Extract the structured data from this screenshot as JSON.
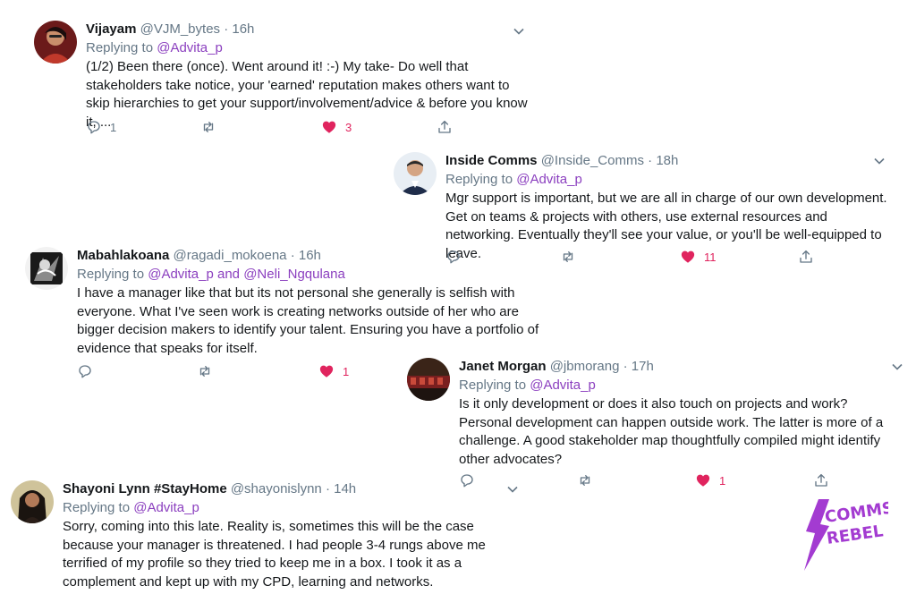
{
  "colors": {
    "accent": "#8b3fbf",
    "like": "#e0245e",
    "muted": "#657786"
  },
  "tweets": [
    {
      "name": "Vijayam",
      "handle": "@VJM_bytes",
      "dot": "·",
      "time": "16h",
      "replying_prefix": "Replying to",
      "replying_to": "@Advita_p",
      "text": "(1/2) Been there (once). Went around it! :-) My take- Do well that stakeholders take notice, your 'earned' reputation makes others want to skip hierarchies to get your support/involvement/advice & before you know it, ...",
      "replies": "1",
      "retweets": "",
      "likes": "3",
      "liked": true
    },
    {
      "name": "Inside Comms",
      "handle": "@Inside_Comms",
      "dot": "·",
      "time": "18h",
      "replying_prefix": "Replying to",
      "replying_to": "@Advita_p",
      "text": "Mgr support is important, but we are all in charge of our own development. Get on teams & projects with others, use external resources and networking. Eventually they'll see your value, or you'll be well-equipped to leave.",
      "replies": "",
      "retweets": "",
      "likes": "11",
      "liked": true
    },
    {
      "name": "Mabahlakoana",
      "handle": "@ragadi_mokoena",
      "dot": "·",
      "time": "16h",
      "replying_prefix": "Replying to",
      "replying_to": "@Advita_p",
      "and": "and",
      "replying_to_2": "@Neli_Ngqulana",
      "text": "I have a manager like that but its not personal she generally is selfish with everyone. What I've seen work is creating networks outside of her who are bigger decision makers to identify your talent. Ensuring you have a portfolio of evidence that speaks for itself.",
      "replies": "",
      "retweets": "",
      "likes": "1",
      "liked": true
    },
    {
      "name": "Janet Morgan",
      "handle": "@jbmorang",
      "dot": "·",
      "time": "17h",
      "replying_prefix": "Replying to",
      "replying_to": "@Advita_p",
      "text": "Is it only development or does it also touch on projects and work? Personal development can happen outside work. The latter is more of a challenge. A good stakeholder map thoughtfully compiled might identify other advocates?",
      "replies": "",
      "retweets": "",
      "likes": "1",
      "liked": true
    },
    {
      "name": "Shayoni Lynn #StayHome",
      "handle": "@shayonislynn",
      "dot": "·",
      "time": "14h",
      "replying_prefix": "Replying to",
      "replying_to": "@Advita_p",
      "text": "Sorry, coming into this late. Reality is, sometimes this will be the case because your manager is threatened. I had people 3-4 rungs above me terrified of my profile so they tried to keep me in a box. I took it as a complement and kept up with my CPD, learning and networks."
    }
  ],
  "logo": {
    "line1": "COMMS",
    "line2": "REBEL",
    "icon": "lightning-bolt-icon"
  }
}
